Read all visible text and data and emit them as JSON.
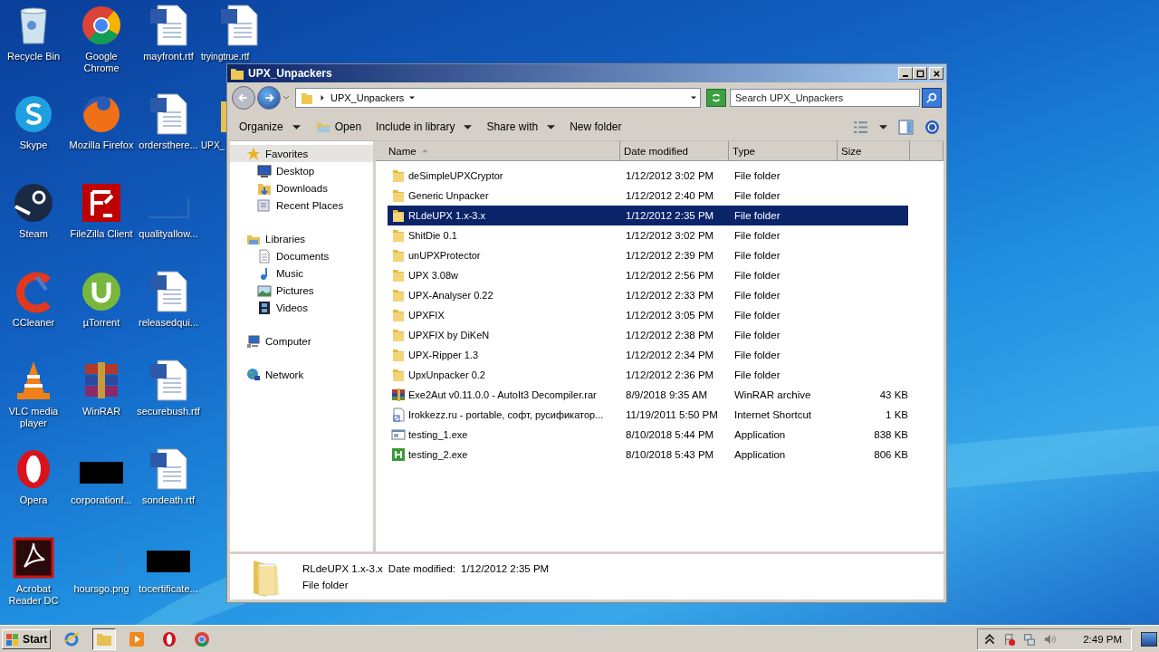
{
  "desktop": {
    "icons": [
      {
        "label": "Recycle Bin",
        "kind": "recycle"
      },
      {
        "label": "Skype",
        "kind": "skype"
      },
      {
        "label": "Steam",
        "kind": "steam"
      },
      {
        "label": "CCleaner",
        "kind": "ccleaner"
      },
      {
        "label": "VLC media player",
        "kind": "vlc"
      },
      {
        "label": "Opera",
        "kind": "opera"
      },
      {
        "label": "Acrobat Reader DC",
        "kind": "acrobat"
      },
      {
        "label": "Google Chrome",
        "kind": "chrome"
      },
      {
        "label": "Mozilla Firefox",
        "kind": "firefox"
      },
      {
        "label": "FileZilla Client",
        "kind": "filezilla"
      },
      {
        "label": "µTorrent",
        "kind": "utorrent"
      },
      {
        "label": "WinRAR",
        "kind": "winrar"
      },
      {
        "label": "corporationf...",
        "kind": "redacted"
      },
      {
        "label": "hoursgo.png",
        "kind": "blank"
      },
      {
        "label": "mayfront.rtf",
        "kind": "word"
      },
      {
        "label": "ordersthere...",
        "kind": "word"
      },
      {
        "label": "qualityallow...",
        "kind": "blank"
      },
      {
        "label": "releasedqui...",
        "kind": "word"
      },
      {
        "label": "securebush.rtf",
        "kind": "word"
      },
      {
        "label": "sondeath.rtf",
        "kind": "word"
      },
      {
        "label": "tocertificate...",
        "kind": "redacted"
      },
      {
        "label": "tryingtrue.rtf",
        "kind": "word"
      },
      {
        "label": "UPX_",
        "kind": "folder"
      }
    ]
  },
  "window": {
    "title": "UPX_Unpackers",
    "address": {
      "path": "UPX_Unpackers",
      "search_placeholder": "Search UPX_Unpackers"
    },
    "toolbar": [
      {
        "label": "Organize",
        "dropdown": true,
        "icon": false
      },
      {
        "label": "Open",
        "dropdown": false,
        "icon": true
      },
      {
        "label": "Include in library",
        "dropdown": true,
        "icon": false
      },
      {
        "label": "Share with",
        "dropdown": true,
        "icon": false
      },
      {
        "label": "New folder",
        "dropdown": false,
        "icon": false
      }
    ],
    "nav": [
      {
        "label": "Favorites",
        "kind": "favorites",
        "selected": true,
        "children": [
          {
            "label": "Desktop",
            "kind": "desktop",
            "selected": false
          },
          {
            "label": "Downloads",
            "kind": "downloads",
            "selected": false
          },
          {
            "label": "Recent Places",
            "kind": "recent",
            "selected": false
          }
        ]
      },
      {
        "label": "Libraries",
        "kind": "libraries",
        "selected": false,
        "children": [
          {
            "label": "Documents",
            "kind": "documents",
            "selected": false
          },
          {
            "label": "Music",
            "kind": "music",
            "selected": false
          },
          {
            "label": "Pictures",
            "kind": "pictures",
            "selected": false
          },
          {
            "label": "Videos",
            "kind": "videos",
            "selected": false
          }
        ]
      },
      {
        "label": "Computer",
        "kind": "computer",
        "selected": false
      },
      {
        "label": "Network",
        "kind": "network",
        "selected": false
      }
    ],
    "columns": [
      "Name",
      "Date modified",
      "Type",
      "Size"
    ],
    "files": [
      {
        "name": "deSimpleUPXCryptor",
        "date": "1/12/2012 3:02 PM",
        "type": "File folder",
        "kind": "folder",
        "selected": false
      },
      {
        "name": "Generic Unpacker",
        "date": "1/12/2012 2:40 PM",
        "type": "File folder",
        "kind": "folder",
        "selected": false
      },
      {
        "name": "RLdeUPX 1.x-3.x",
        "date": "1/12/2012 2:35 PM",
        "type": "File folder",
        "kind": "folder",
        "selected": true
      },
      {
        "name": "ShitDie 0.1",
        "date": "1/12/2012 3:02 PM",
        "type": "File folder",
        "kind": "folder",
        "selected": false
      },
      {
        "name": "unUPXProtector",
        "date": "1/12/2012 2:39 PM",
        "type": "File folder",
        "kind": "folder",
        "selected": false
      },
      {
        "name": "UPX 3.08w",
        "date": "1/12/2012 2:56 PM",
        "type": "File folder",
        "kind": "folder",
        "selected": false
      },
      {
        "name": "UPX-Analyser 0.22",
        "date": "1/12/2012 2:33 PM",
        "type": "File folder",
        "kind": "folder",
        "selected": false
      },
      {
        "name": "UPXFIX",
        "date": "1/12/2012 3:05 PM",
        "type": "File folder",
        "kind": "folder",
        "selected": false
      },
      {
        "name": "UPXFIX by DiKeN",
        "date": "1/12/2012 2:38 PM",
        "type": "File folder",
        "kind": "folder",
        "selected": false
      },
      {
        "name": "UPX-Ripper 1.3",
        "date": "1/12/2012 2:34 PM",
        "type": "File folder",
        "kind": "folder",
        "selected": false
      },
      {
        "name": "UpxUnpacker 0.2",
        "date": "1/12/2012 2:36 PM",
        "type": "File folder",
        "kind": "folder",
        "selected": false
      },
      {
        "name": "Exe2Aut v0.11.0.0 - AutoIt3 Decompiler.rar",
        "date": "8/9/2018 9:35 AM",
        "type": "WinRAR archive",
        "size": "43 KB",
        "kind": "rar",
        "selected": false
      },
      {
        "name": "Irokkezz.ru - portable, софт, русификатор...",
        "date": "11/19/2011 5:50 PM",
        "type": "Internet Shortcut",
        "size": "1 KB",
        "kind": "url",
        "selected": false
      },
      {
        "name": "testing_1.exe",
        "date": "8/10/2018 5:44 PM",
        "type": "Application",
        "size": "838 KB",
        "kind": "exe",
        "selected": false
      },
      {
        "name": "testing_2.exe",
        "date": "8/10/2018 5:43 PM",
        "type": "Application",
        "size": "806 KB",
        "kind": "app",
        "selected": false
      }
    ],
    "details": {
      "name": "RLdeUPX 1.x-3.x",
      "date_label": "Date modified:",
      "date": "1/12/2012 2:35 PM",
      "type": "File folder"
    }
  },
  "taskbar": {
    "start": "Start",
    "apps": [
      {
        "kind": "ie",
        "active": false
      },
      {
        "kind": "explorer",
        "active": true
      },
      {
        "kind": "media",
        "active": false
      },
      {
        "kind": "opera",
        "active": false
      },
      {
        "kind": "chrome",
        "active": false
      }
    ],
    "clock": "2:49 PM"
  }
}
